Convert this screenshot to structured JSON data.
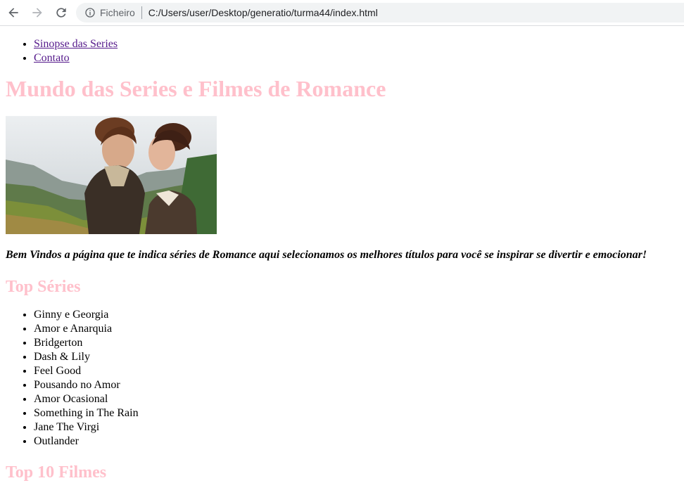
{
  "browser": {
    "scheme_label": "Ficheiro",
    "url": "C:/Users/user/Desktop/generatio/turma44/index.html"
  },
  "nav": {
    "items": [
      {
        "label": "Sinopse das Series"
      },
      {
        "label": "Contato"
      }
    ]
  },
  "page": {
    "title": "Mundo das Series e Filmes de Romance",
    "welcome": "Bem Vindos a página que te indica séries de Romance aqui selecionamos os melhores títulos para você se inspirar se divertir e emocionar!",
    "top_series_heading": "Top Séries",
    "series": [
      "Ginny e Georgia",
      "Amor e Anarquia",
      "Bridgerton",
      "Dash & Lily",
      "Feel Good",
      "Pousando no Amor",
      "Amor Ocasional",
      "Something in The Rain",
      "Jane The Virgi",
      "Outlander"
    ],
    "top_films_heading": "Top 10 Filmes"
  },
  "colors": {
    "heading": "#ffc0cb",
    "visited_link": "#551a8b"
  }
}
